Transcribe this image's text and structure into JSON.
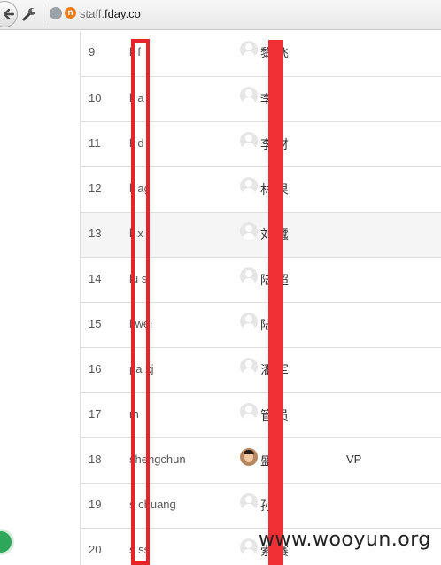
{
  "browser": {
    "url_prefix": "staff.",
    "url_domain": "fday.co",
    "extension_badge": "n"
  },
  "table": {
    "rows": [
      {
        "num": "9",
        "user": "li f",
        "name": "黎  飞",
        "title": "",
        "avatar": "default",
        "hover": false
      },
      {
        "num": "10",
        "user": "li a",
        "name": "李  ",
        "title": "",
        "avatar": "default",
        "hover": false
      },
      {
        "num": "11",
        "user": "li d",
        "name": "李  财",
        "title": "",
        "avatar": "default",
        "hover": false
      },
      {
        "num": "12",
        "user": "li ag",
        "name": "林  果",
        "title": "",
        "avatar": "default",
        "hover": false
      },
      {
        "num": "13",
        "user": "li x",
        "name": "刘  蠶",
        "title": "",
        "avatar": "default",
        "hover": true
      },
      {
        "num": "14",
        "user": "lu s",
        "name": "陆  超",
        "title": "",
        "avatar": "default",
        "hover": false
      },
      {
        "num": "15",
        "user": "l  wei",
        "name": "陆  ",
        "title": "",
        "avatar": "default",
        "hover": false
      },
      {
        "num": "16",
        "user": "pa  xj",
        "name": "潘  军",
        "title": "",
        "avatar": "default",
        "hover": false
      },
      {
        "num": "17",
        "user": "m ",
        "name": "管  员",
        "title": "",
        "avatar": "default",
        "hover": false
      },
      {
        "num": "18",
        "user": "shengchun",
        "name": "盛  ",
        "title": "VP",
        "avatar": "photo",
        "hover": false
      },
      {
        "num": "19",
        "user": "s  chuang",
        "name": "孙  ",
        "title": "",
        "avatar": "default",
        "hover": false
      },
      {
        "num": "20",
        "user": "s  ss",
        "name": "索  赛",
        "title": "",
        "avatar": "default",
        "hover": false
      }
    ]
  },
  "watermark": "www.wooyun.org",
  "colors": {
    "redaction": "#e8232a",
    "row_border": "#dddddd",
    "hover_row": "#f5f5f5"
  }
}
